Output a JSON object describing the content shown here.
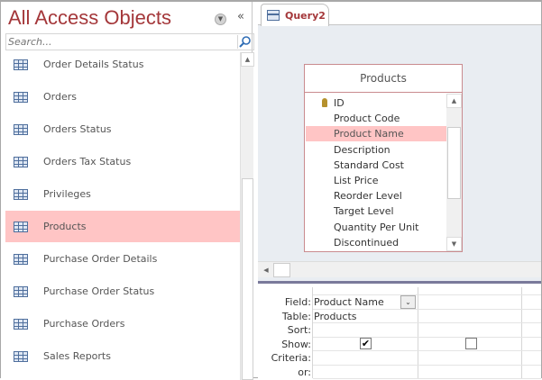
{
  "nav": {
    "title": "All Access Objects",
    "menu_icon": "chevron-down-circle-icon",
    "collapse_icon": "double-chevron-left-icon",
    "search_placeholder": "Search...",
    "items": [
      {
        "label": "Order Details Status",
        "selected": false
      },
      {
        "label": "Orders",
        "selected": false
      },
      {
        "label": "Orders Status",
        "selected": false
      },
      {
        "label": "Orders Tax Status",
        "selected": false
      },
      {
        "label": "Privileges",
        "selected": false
      },
      {
        "label": "Products",
        "selected": true
      },
      {
        "label": "Purchase Order Details",
        "selected": false
      },
      {
        "label": "Purchase Order Status",
        "selected": false
      },
      {
        "label": "Purchase Orders",
        "selected": false
      },
      {
        "label": "Sales Reports",
        "selected": false
      }
    ]
  },
  "tab": {
    "label": "Query2"
  },
  "field_list": {
    "title": "Products",
    "fields": [
      "ID",
      "Product Code",
      "Product Name",
      "Description",
      "Standard Cost",
      "List Price",
      "Reorder Level",
      "Target Level",
      "Quantity Per Unit",
      "Discontinued"
    ],
    "selected": "Product Name",
    "primary_key": "ID"
  },
  "grid": {
    "row_labels": [
      "Field:",
      "Table:",
      "Sort:",
      "Show:",
      "Criteria:",
      "or:"
    ],
    "columns": [
      {
        "field": "Product Name",
        "table": "Products",
        "show": true
      },
      {
        "field": "",
        "table": "",
        "show": false
      }
    ]
  },
  "colors": {
    "accent": "#a4373a",
    "selection": "#ffc5c5",
    "designer_bg": "#e9edf2"
  }
}
